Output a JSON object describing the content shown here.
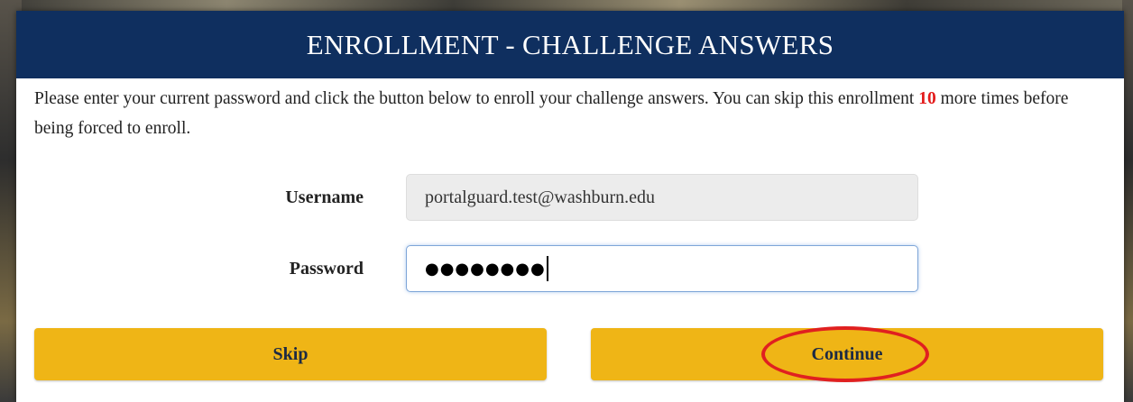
{
  "dialog": {
    "title": "ENROLLMENT - CHALLENGE ANSWERS",
    "instructions_before": "Please enter your current password and click the button below to enroll your challenge answers. You can skip this enrollment ",
    "skip_count": "10",
    "instructions_after": " more times before being forced to enroll."
  },
  "form": {
    "username_label": "Username",
    "username_value": "portalguard.test@washburn.edu",
    "password_label": "Password",
    "password_masked": "●●●●●●●●"
  },
  "buttons": {
    "skip_label": "Skip",
    "continue_label": "Continue"
  },
  "colors": {
    "header_bg": "#0f2f5f",
    "button_bg": "#efb516",
    "count_text": "#e31b1b",
    "annotation_circle": "#e02020"
  },
  "annotation": {
    "highlighted_element": "continue-button"
  }
}
